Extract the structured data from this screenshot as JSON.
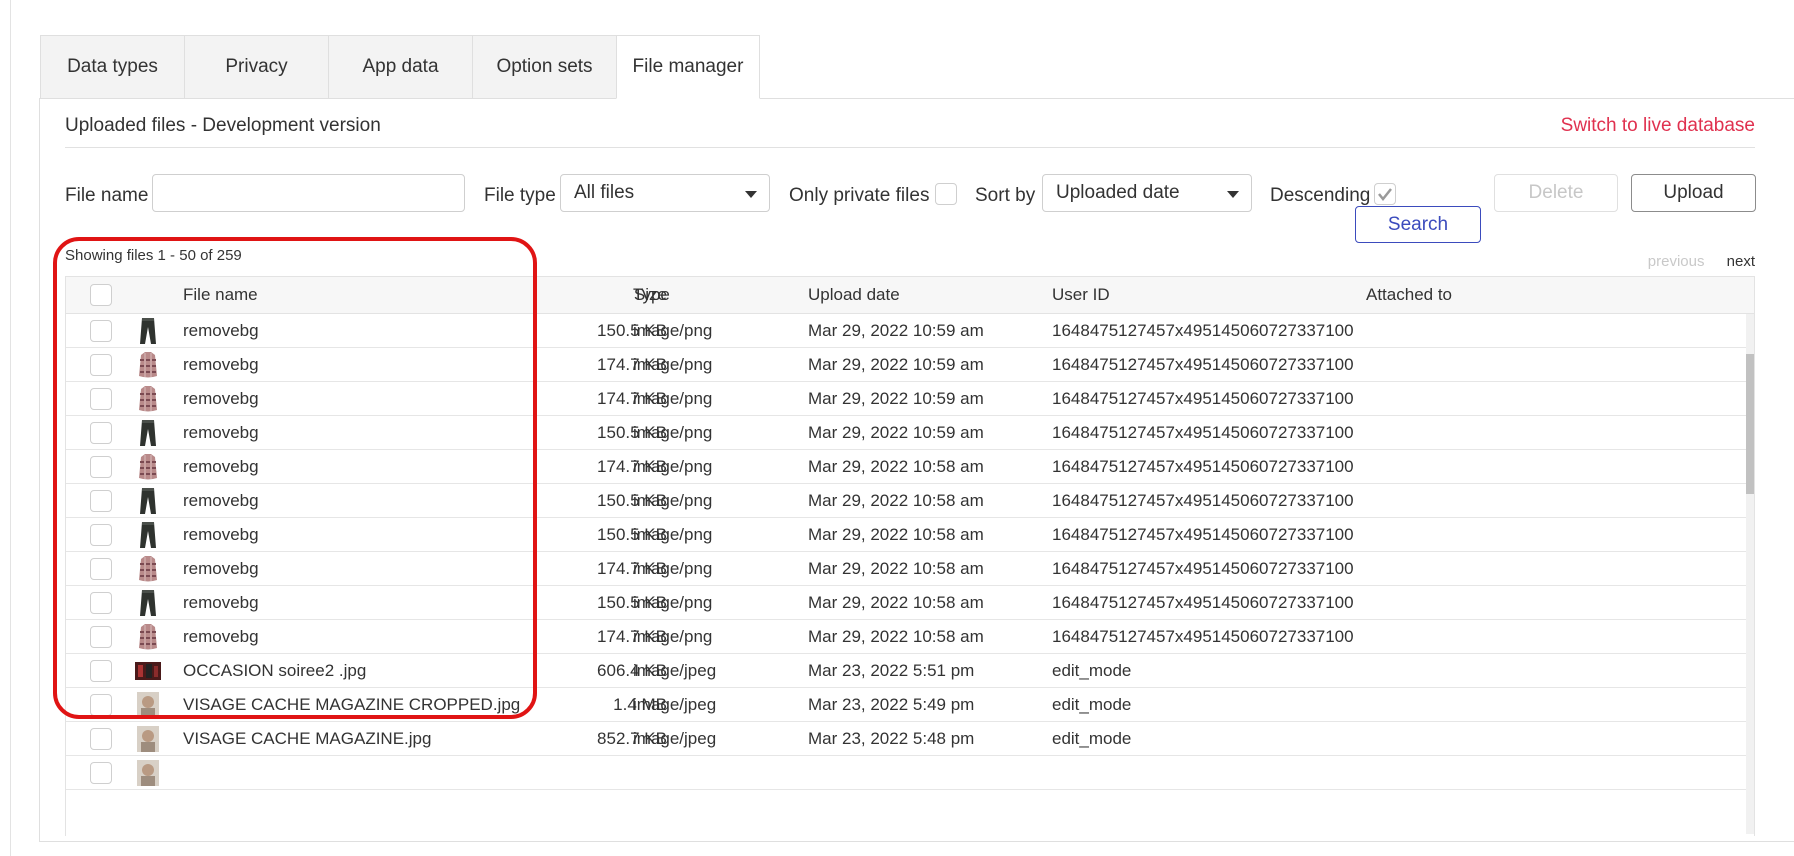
{
  "tabs": [
    {
      "label": "Data types",
      "active": false
    },
    {
      "label": "Privacy",
      "active": false
    },
    {
      "label": "App data",
      "active": false
    },
    {
      "label": "Option sets",
      "active": false
    },
    {
      "label": "File manager",
      "active": true
    }
  ],
  "header": {
    "title": "Uploaded files - Development version",
    "live_link": "Switch to live database"
  },
  "filters": {
    "file_name_label": "File name",
    "file_name_value": "",
    "file_type_label": "File type",
    "file_type_value": "All files",
    "private_label": "Only private files",
    "private_checked": false,
    "sort_label": "Sort by",
    "sort_value": "Uploaded date",
    "descending_label": "Descending",
    "descending_checked": true,
    "delete_label": "Delete",
    "upload_label": "Upload",
    "search_label": "Search"
  },
  "showing": "Showing files 1 - 50 of 259",
  "pager": {
    "previous": "previous",
    "next": "next"
  },
  "columns": {
    "name": "File name",
    "size": "Size",
    "type": "Type",
    "date": "Upload date",
    "user": "User ID",
    "attached": "Attached to"
  },
  "rows": [
    {
      "thumb": "pants",
      "name": "removebg",
      "size": "150.5 KB",
      "type": "image/png",
      "date": "Mar 29, 2022 10:59 am",
      "user": "1648475127457x495145060727337100",
      "attached": ""
    },
    {
      "thumb": "plaid-shirt",
      "name": "removebg",
      "size": "174.7 KB",
      "type": "image/png",
      "date": "Mar 29, 2022 10:59 am",
      "user": "1648475127457x495145060727337100",
      "attached": ""
    },
    {
      "thumb": "plaid-shirt",
      "name": "removebg",
      "size": "174.7 KB",
      "type": "image/png",
      "date": "Mar 29, 2022 10:59 am",
      "user": "1648475127457x495145060727337100",
      "attached": ""
    },
    {
      "thumb": "pants",
      "name": "removebg",
      "size": "150.5 KB",
      "type": "image/png",
      "date": "Mar 29, 2022 10:59 am",
      "user": "1648475127457x495145060727337100",
      "attached": ""
    },
    {
      "thumb": "plaid-shirt",
      "name": "removebg",
      "size": "174.7 KB",
      "type": "image/png",
      "date": "Mar 29, 2022 10:58 am",
      "user": "1648475127457x495145060727337100",
      "attached": ""
    },
    {
      "thumb": "pants",
      "name": "removebg",
      "size": "150.5 KB",
      "type": "image/png",
      "date": "Mar 29, 2022 10:58 am",
      "user": "1648475127457x495145060727337100",
      "attached": ""
    },
    {
      "thumb": "pants",
      "name": "removebg",
      "size": "150.5 KB",
      "type": "image/png",
      "date": "Mar 29, 2022 10:58 am",
      "user": "1648475127457x495145060727337100",
      "attached": ""
    },
    {
      "thumb": "plaid-shirt",
      "name": "removebg",
      "size": "174.7 KB",
      "type": "image/png",
      "date": "Mar 29, 2022 10:58 am",
      "user": "1648475127457x495145060727337100",
      "attached": ""
    },
    {
      "thumb": "pants",
      "name": "removebg",
      "size": "150.5 KB",
      "type": "image/png",
      "date": "Mar 29, 2022 10:58 am",
      "user": "1648475127457x495145060727337100",
      "attached": ""
    },
    {
      "thumb": "plaid-shirt",
      "name": "removebg",
      "size": "174.7 KB",
      "type": "image/png",
      "date": "Mar 29, 2022 10:58 am",
      "user": "1648475127457x495145060727337100",
      "attached": ""
    },
    {
      "thumb": "photo-dark",
      "name": "OCCASION soiree2 .jpg",
      "size": "606.4 KB",
      "type": "image/jpeg",
      "date": "Mar 23, 2022 5:51 pm",
      "user": "edit_mode",
      "attached": ""
    },
    {
      "thumb": "photo-face",
      "name": "VISAGE CACHE MAGAZINE CROPPED.jpg",
      "size": "1.4 MB",
      "type": "image/jpeg",
      "date": "Mar 23, 2022 5:49 pm",
      "user": "edit_mode",
      "attached": ""
    },
    {
      "thumb": "photo-face",
      "name": "VISAGE CACHE MAGAZINE.jpg",
      "size": "852.7 KB",
      "type": "image/jpeg",
      "date": "Mar 23, 2022 5:48 pm",
      "user": "edit_mode",
      "attached": ""
    },
    {
      "thumb": "photo-face",
      "name": "",
      "size": "",
      "type": "",
      "date": "",
      "user": "",
      "attached": ""
    }
  ],
  "colors": {
    "accent_link": "#e0314f",
    "search_button": "#3b4bbd",
    "annotation": "#e01414"
  }
}
